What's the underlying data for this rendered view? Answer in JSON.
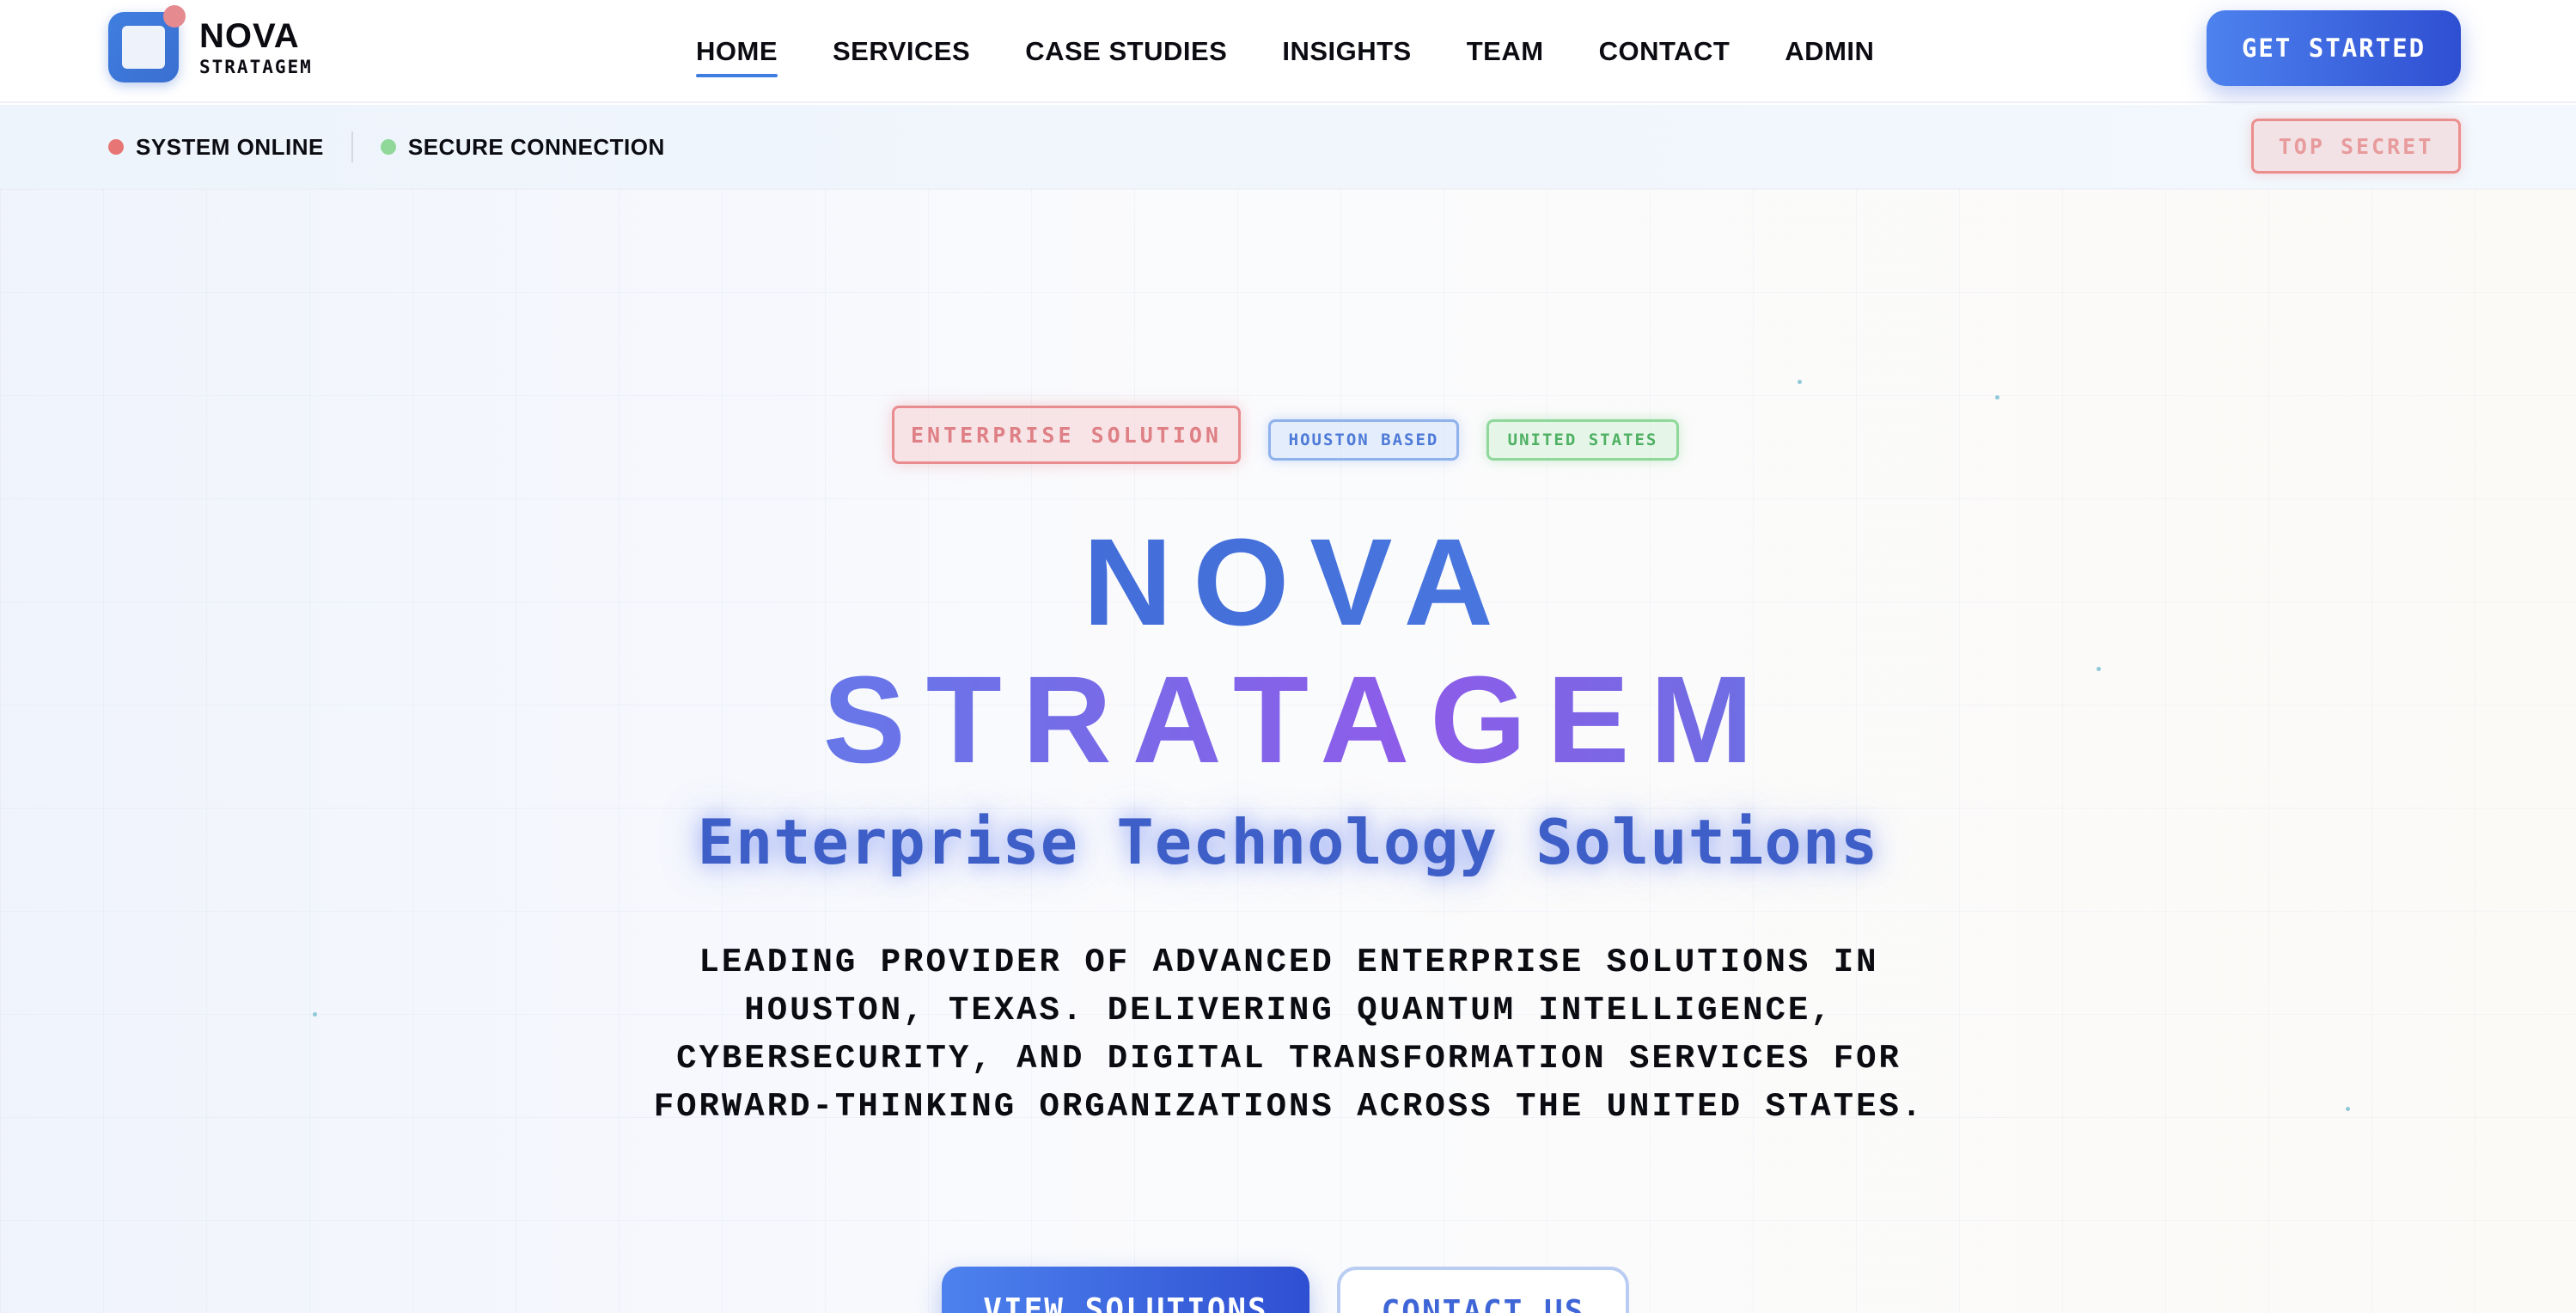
{
  "header": {
    "logo": {
      "line1": "NOVA",
      "line2": "STRATAGEM"
    },
    "nav": [
      {
        "label": "HOME",
        "active": true
      },
      {
        "label": "SERVICES",
        "active": false
      },
      {
        "label": "CASE STUDIES",
        "active": false
      },
      {
        "label": "INSIGHTS",
        "active": false
      },
      {
        "label": "TEAM",
        "active": false
      },
      {
        "label": "CONTACT",
        "active": false
      },
      {
        "label": "ADMIN",
        "active": false
      }
    ],
    "cta_label": "GET STARTED"
  },
  "statusbar": {
    "items": [
      {
        "label": "SYSTEM ONLINE",
        "color": "#e87575"
      },
      {
        "label": "SECURE CONNECTION",
        "color": "#8fd89a"
      }
    ],
    "badge": "TOP SECRET"
  },
  "hero": {
    "tags": [
      "ENTERPRISE SOLUTION",
      "HOUSTON BASED",
      "UNITED STATES"
    ],
    "title_line1": "NOVA",
    "title_line2": "STRATAGEM",
    "subtitle": "Enterprise Technology Solutions",
    "description": "LEADING PROVIDER OF ADVANCED ENTERPRISE SOLUTIONS IN HOUSTON, TEXAS. DELIVERING QUANTUM INTELLIGENCE, CYBERSECURITY, AND DIGITAL TRANSFORMATION SERVICES FOR FORWARD-THINKING ORGANIZATIONS ACROSS THE UNITED STATES.",
    "primary_button": "VIEW SOLUTIONS",
    "secondary_button": "CONTACT US"
  },
  "colors": {
    "accent": "#3f7ee0",
    "button_gradient_start": "#4d82ee",
    "button_gradient_end": "#2f4fd2",
    "status_online": "#e87575",
    "status_secure": "#8fd89a",
    "badge_red": "#ec8e8e"
  }
}
